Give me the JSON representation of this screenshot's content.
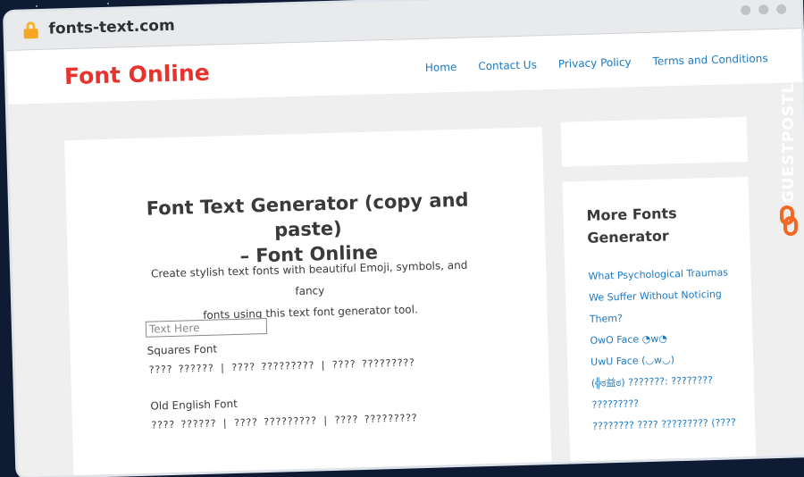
{
  "browser": {
    "url": "fonts-text.com"
  },
  "header": {
    "logo": "Font Online",
    "nav": [
      "Home",
      "Contact Us",
      "Privacy Policy",
      "Terms and Conditions"
    ]
  },
  "main": {
    "title_line1": "Font Text Generator (copy and paste)",
    "title_line2": "– Font Online",
    "description_line1": "Create stylish text fonts with beautiful Emoji, symbols, and fancy",
    "description_line2": "fonts using this text font generator tool.",
    "input_placeholder": "Text Here",
    "fonts": [
      {
        "name": "Squares Font",
        "sample": "???? ?????? | ???? ????????? | ???? ?????????"
      },
      {
        "name": "Old English Font",
        "sample": "???? ?????? | ???? ????????? | ???? ?????????"
      }
    ]
  },
  "sidebar": {
    "title_line1": "More Fonts",
    "title_line2": "Generator",
    "links": [
      "What Psychological Traumas",
      "We Suffer Without Noticing",
      "Them?",
      "OwO Face ◔w◔",
      "UwU Face (◡w◡)",
      "(╬ಠ益ಠ) ???????: ????????",
      "?????????",
      "???????? ???? ????????? (????"
    ]
  },
  "watermark": {
    "text": "GUESTPOSTLINKS"
  },
  "colors": {
    "logo": "#e8322d",
    "link": "#1b79c4",
    "background": "#0f1b33",
    "watermark_accent": "#f26a21"
  }
}
